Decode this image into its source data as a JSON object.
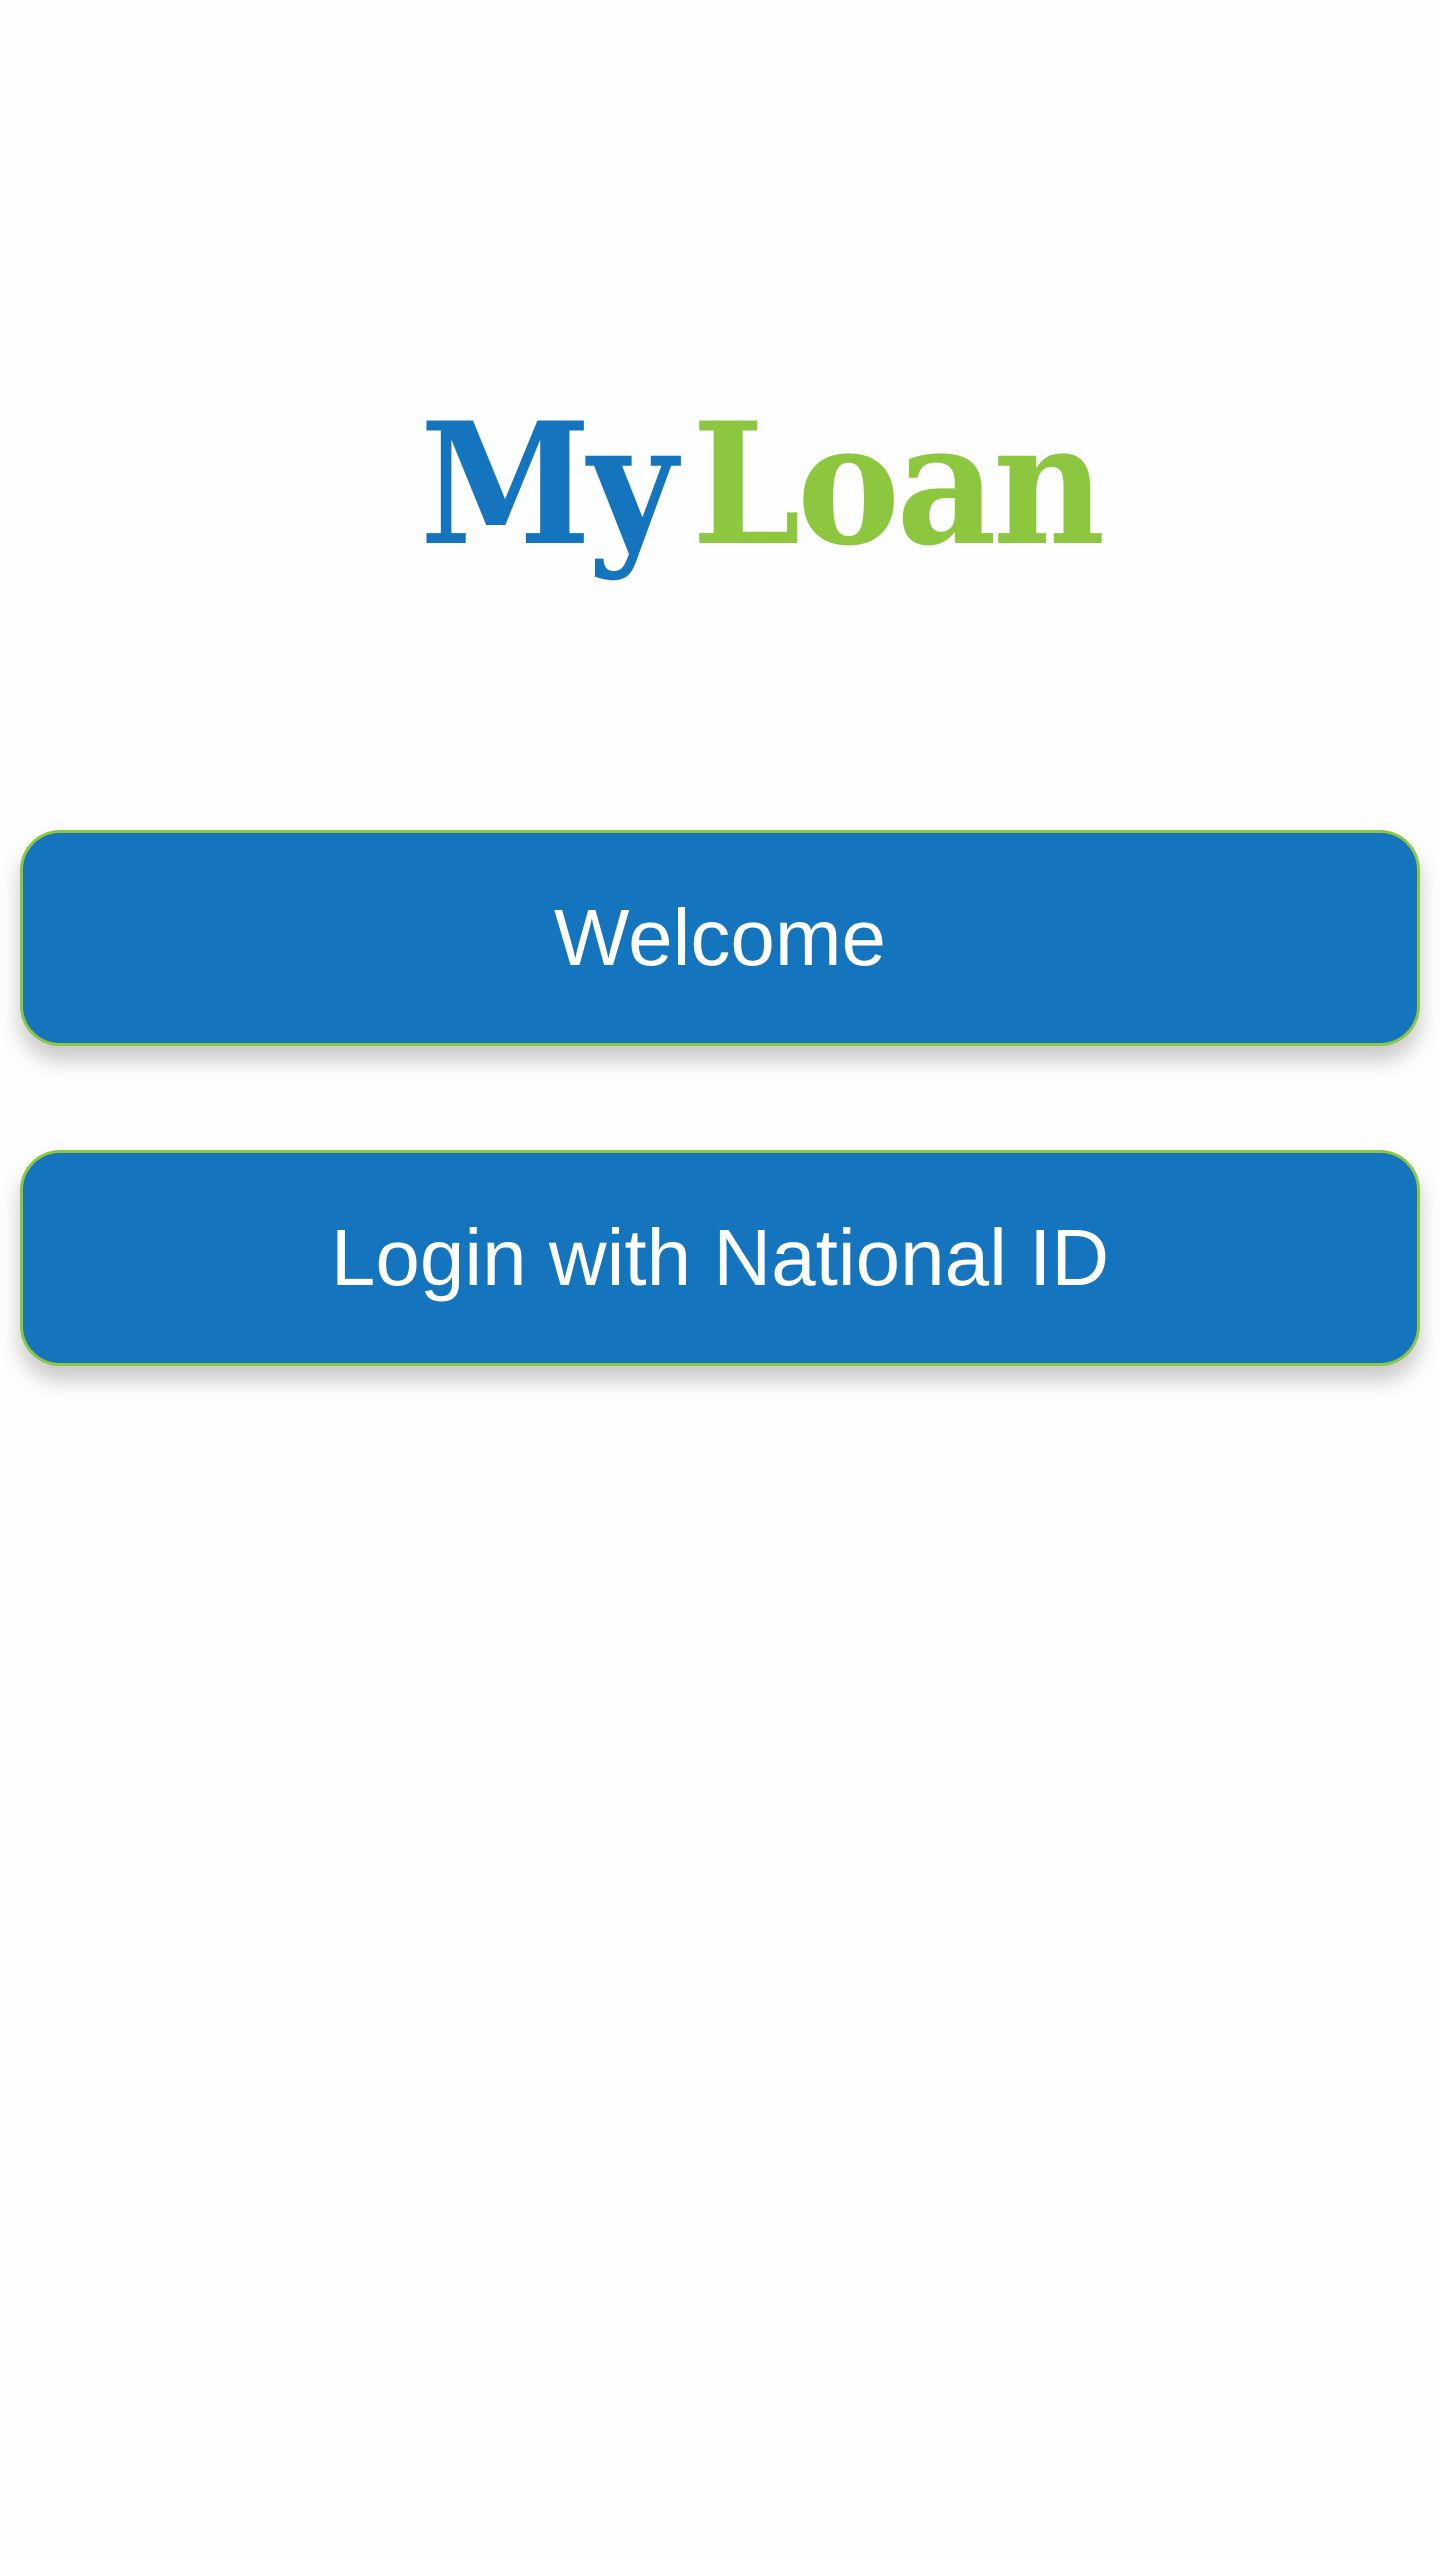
{
  "logo": {
    "part_my": "My",
    "part_loan": "Loan",
    "icon": "hand-lock-icon",
    "colors": {
      "my": "#1474bd",
      "loan": "#8dc63f",
      "icon": "#1c2a5a"
    }
  },
  "buttons": {
    "welcome_label": "Welcome",
    "login_label": "Login with National ID"
  },
  "colors": {
    "button_fill": "#1474bd",
    "button_border": "#8dc63f",
    "button_text": "#ffffff",
    "background": "#fefefe"
  }
}
